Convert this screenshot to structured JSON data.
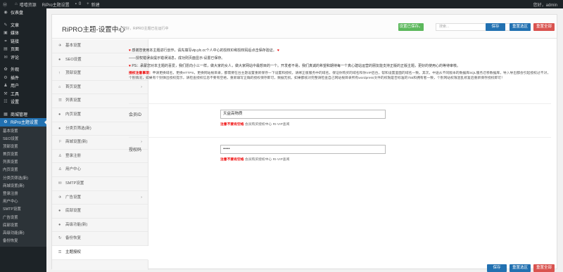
{
  "adminbar": {
    "wp_icon": "wordpress-icon",
    "site_name": "嘻嘻资源",
    "theme_settings": "RiPro主题设置",
    "comments_count": "0",
    "new_label": "新建",
    "greeting": "您好，admin"
  },
  "menu": {
    "items": [
      {
        "icon": "dashboard-icon",
        "glyph": "◉",
        "label": "仪表盘"
      },
      {
        "icon": "pin-icon",
        "glyph": "✎",
        "label": "文章"
      },
      {
        "icon": "media-icon",
        "glyph": "▣",
        "label": "媒体"
      },
      {
        "icon": "link-icon",
        "glyph": "⚭",
        "label": "链接"
      },
      {
        "icon": "pages-icon",
        "glyph": "▤",
        "label": "页面"
      },
      {
        "icon": "comment-icon",
        "glyph": "✉",
        "label": "评论"
      },
      {
        "icon": "appearance-icon",
        "glyph": "✿",
        "label": "外观"
      },
      {
        "icon": "plugin-icon",
        "glyph": "⚙",
        "label": "插件"
      },
      {
        "icon": "users-icon",
        "glyph": "♟",
        "label": "用户"
      },
      {
        "icon": "tools-icon",
        "glyph": "⚒",
        "label": "工具"
      },
      {
        "icon": "settings-icon",
        "glyph": "☷",
        "label": "设置"
      },
      {
        "icon": "shop-icon",
        "glyph": "▦",
        "label": "商城管理"
      },
      {
        "icon": "gear-icon",
        "glyph": "⚙",
        "label": "RiPro主题设置"
      }
    ],
    "submenu": [
      "基本设置",
      "SEO设置",
      "顶部设置",
      "首页设置",
      "列表设置",
      "内页设置",
      "分类页筛选(新)",
      "商城设置(新)",
      "登录注册",
      "用户中心",
      "SMTP设置",
      "广告设置",
      "底部设置",
      "高级功能(新)",
      "备份恢复"
    ]
  },
  "header": {
    "title": "RiPRO主题-设置中心",
    "subtitle": "您好，RiPRO主题已在运行中",
    "restore_button": "设置已保存。",
    "search_placeholder": "搜索...",
    "save": "保存",
    "reset_section": "重置选区",
    "reset_all": "重置全部"
  },
  "nav": [
    {
      "icon": "pin-icon",
      "glyph": "✈",
      "label": "基本设置",
      "arrow": false
    },
    {
      "icon": "circle-icon",
      "glyph": "●",
      "label": "SEO设置",
      "arrow": false
    },
    {
      "icon": "arrow-up-icon",
      "glyph": "↑",
      "label": "顶部设置",
      "arrow": false
    },
    {
      "icon": "home-icon",
      "glyph": "⌂",
      "label": "首页设置",
      "arrow": true
    },
    {
      "icon": "list-icon",
      "glyph": "☰",
      "label": "列表设置",
      "arrow": false
    },
    {
      "icon": "circle-icon",
      "glyph": "●",
      "label": "内页设置",
      "arrow": false
    },
    {
      "icon": "circle-icon",
      "glyph": "●",
      "label": "分类页筛选(新)",
      "arrow": false
    },
    {
      "icon": "shop-icon",
      "glyph": "⚐",
      "label": "商城设置(新)",
      "arrow": true
    },
    {
      "icon": "user-icon",
      "glyph": "♙",
      "label": "登录注册",
      "arrow": false
    },
    {
      "icon": "user-center-icon",
      "glyph": "♙",
      "label": "用户中心",
      "arrow": false
    },
    {
      "icon": "mail-icon",
      "glyph": "✉",
      "label": "SMTP设置",
      "arrow": false
    },
    {
      "icon": "ad-icon",
      "glyph": "✈",
      "label": "广告设置",
      "arrow": true
    },
    {
      "icon": "circle-icon",
      "glyph": "●",
      "label": "底部设置",
      "arrow": false
    },
    {
      "icon": "circle-icon",
      "glyph": "●",
      "label": "高级功能(新)",
      "arrow": false
    },
    {
      "icon": "backup-icon",
      "glyph": "↻",
      "label": "备份恢复",
      "arrow": false
    },
    {
      "icon": "key-icon",
      "glyph": "⚿",
      "label": "主题授权",
      "arrow": false
    }
  ],
  "notice": {
    "line1": "感谢您使用本主题进行创作，请先填写vip.ylc.cc个人中心的授权ID和授权码后点击保存验证。",
    "line2": "——授权错误会提示错误消息，成功则页面显示:设置已保存。",
    "line3": "PS：承蒙您对本主题的喜爱，我们愿向小三一样，做大家的女人，做大家网站中最想目的一个。开发者不易，我们真诚的希望和期待每一个真心建站运营的朋友能支持正版的正版主题，更好的使用心的等待审核。",
    "warn_title": "授权注意事项：",
    "warn_body": "申请更换域名，更换HTTPS，更换网站根目录，都需要在台主题设置重新保存一下设置和授权，请绑正版服务中的域名，保证你购买的域名和你VIP后台，帮和设置里面的域名一致。其次，中途从不同版本的数据库SQL服务迁移数据库，导入导出都会引起授权过不对，个别情况，如果有个别弹出授权提示，请检查授权信息不要有空格，重新填写正确的授权保存即可，数据无损。如果都核对完整请检查自己网站根目录所有wordpress文件的权限是否标准的755和拥有者一致，个别网站权限混乱修复后重新保存授权即可！"
  },
  "fields": {
    "member_id": {
      "label": "会员ID",
      "value": "天益高物质",
      "hint_red": "注意不要有空格",
      "hint": "会员购买授权中心 RI-VIP查阅"
    },
    "auth_code": {
      "label": "授权码",
      "value": "•••••",
      "hint_red": "注意不要有空格",
      "hint": "会员购买授权中心 RI-VIP查阅"
    }
  },
  "colors": {
    "primary": "#2271b1",
    "green": "#5cb85c",
    "red": "#d9534f",
    "accent_red": "#e00"
  }
}
